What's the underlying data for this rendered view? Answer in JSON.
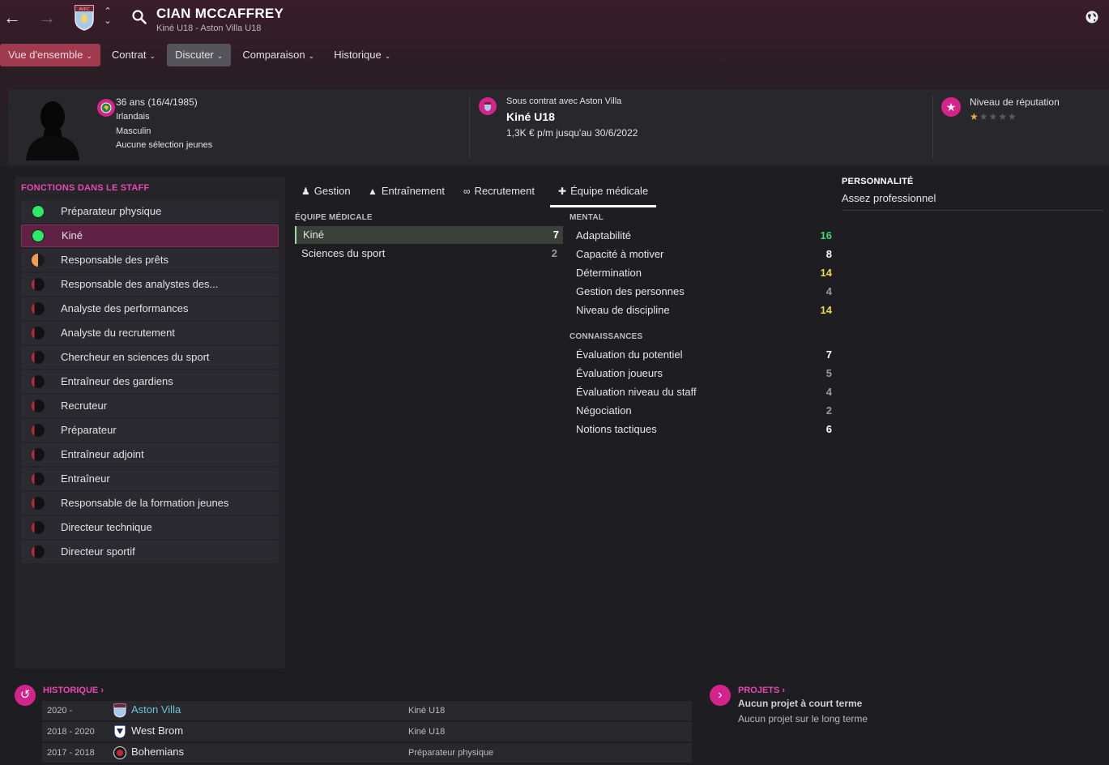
{
  "header": {
    "player_name": "CIAN MCCAFFREY",
    "subtitle": "Kiné U18 - Aston Villa U18",
    "crest_text": "AVFC"
  },
  "menu": [
    {
      "label": "Vue d'ensemble"
    },
    {
      "label": "Contrat"
    },
    {
      "label": "Discuter"
    },
    {
      "label": "Comparaison"
    },
    {
      "label": "Historique"
    }
  ],
  "profile": {
    "age": "36 ans (16/4/1985)",
    "nationality": "Irlandais",
    "gender": "Masculin",
    "youth_caps": "Aucune sélection jeunes"
  },
  "contract": {
    "label": "Sous contrat avec Aston Villa",
    "role": "Kiné U18",
    "wage": "1,3K € p/m jusqu'au 30/6/2022"
  },
  "reputation": {
    "label": "Niveau de réputation",
    "stars_value": 0.5,
    "stars_max": 5
  },
  "staff_functions": {
    "title": "FONCTIONS DANS LE STAFF",
    "items": [
      {
        "label": "Préparateur physique",
        "level": "green"
      },
      {
        "label": "Kiné",
        "level": "green"
      },
      {
        "label": "Responsable des prêts",
        "level": "orange-half"
      },
      {
        "label": "Responsable des analystes des...",
        "level": "red-low"
      },
      {
        "label": "Analyste des performances",
        "level": "red-low"
      },
      {
        "label": "Analyste du recrutement",
        "level": "red-low"
      },
      {
        "label": "Chercheur en sciences du sport",
        "level": "red-low"
      },
      {
        "label": "Entraîneur des gardiens",
        "level": "red-low"
      },
      {
        "label": "Recruteur",
        "level": "red-low"
      },
      {
        "label": "Préparateur",
        "level": "red-low"
      },
      {
        "label": "Entraîneur adjoint",
        "level": "red-low"
      },
      {
        "label": "Entraîneur",
        "level": "red-low"
      },
      {
        "label": "Responsable de la formation jeunes",
        "level": "red-low"
      },
      {
        "label": "Directeur technique",
        "level": "red-low"
      },
      {
        "label": "Directeur sportif",
        "level": "red-low"
      }
    ]
  },
  "tabs": [
    {
      "label": "Gestion",
      "icon": "person-icon"
    },
    {
      "label": "Entraînement",
      "icon": "cone-icon"
    },
    {
      "label": "Recrutement",
      "icon": "binoculars-icon"
    },
    {
      "label": "Équipe médicale",
      "icon": "medical-kit-icon"
    }
  ],
  "medical": {
    "title": "ÉQUIPE MÉDICALE",
    "rows": [
      {
        "label": "Kiné",
        "value": "7"
      },
      {
        "label": "Sciences du sport",
        "value": "2"
      }
    ]
  },
  "mental": {
    "title": "MENTAL",
    "rows": [
      {
        "label": "Adaptabilité",
        "value": "16",
        "color": "#3ddc6e"
      },
      {
        "label": "Capacité à motiver",
        "value": "8",
        "color": "#ffffff"
      },
      {
        "label": "Détermination",
        "value": "14",
        "color": "#f0d64a"
      },
      {
        "label": "Gestion des personnes",
        "value": "4",
        "color": "#9a9aa0"
      },
      {
        "label": "Niveau de discipline",
        "value": "14",
        "color": "#f0d64a"
      }
    ]
  },
  "knowledge": {
    "title": "CONNAISSANCES",
    "rows": [
      {
        "label": "Évaluation du potentiel",
        "value": "7",
        "color": "#ffffff"
      },
      {
        "label": "Évaluation joueurs",
        "value": "5",
        "color": "#9a9aa0"
      },
      {
        "label": "Évaluation niveau du staff",
        "value": "4",
        "color": "#9a9aa0"
      },
      {
        "label": "Négociation",
        "value": "2",
        "color": "#9a9aa0"
      },
      {
        "label": "Notions tactiques",
        "value": "6",
        "color": "#ffffff"
      }
    ]
  },
  "personality": {
    "title": "PERSONNALITÉ",
    "value": "Assez professionnel"
  },
  "history": {
    "title": "HISTORIQUE",
    "rows": [
      {
        "years": "2020 -",
        "club": "Aston Villa",
        "role": "Kiné U18"
      },
      {
        "years": "2018 - 2020",
        "club": "West Brom",
        "role": "Kiné U18"
      },
      {
        "years": "2017 - 2018",
        "club": "Bohemians",
        "role": "Préparateur physique"
      }
    ]
  },
  "projects": {
    "title": "PROJETS",
    "short_term": "Aucun projet à court terme",
    "long_term": "Aucun projet sur le long terme"
  },
  "colors": {
    "accent": "#d4248c",
    "active_menu": "#a03a4e",
    "green": "#2ee86a",
    "orange": "#f0a04a",
    "red": "#c0283c"
  }
}
